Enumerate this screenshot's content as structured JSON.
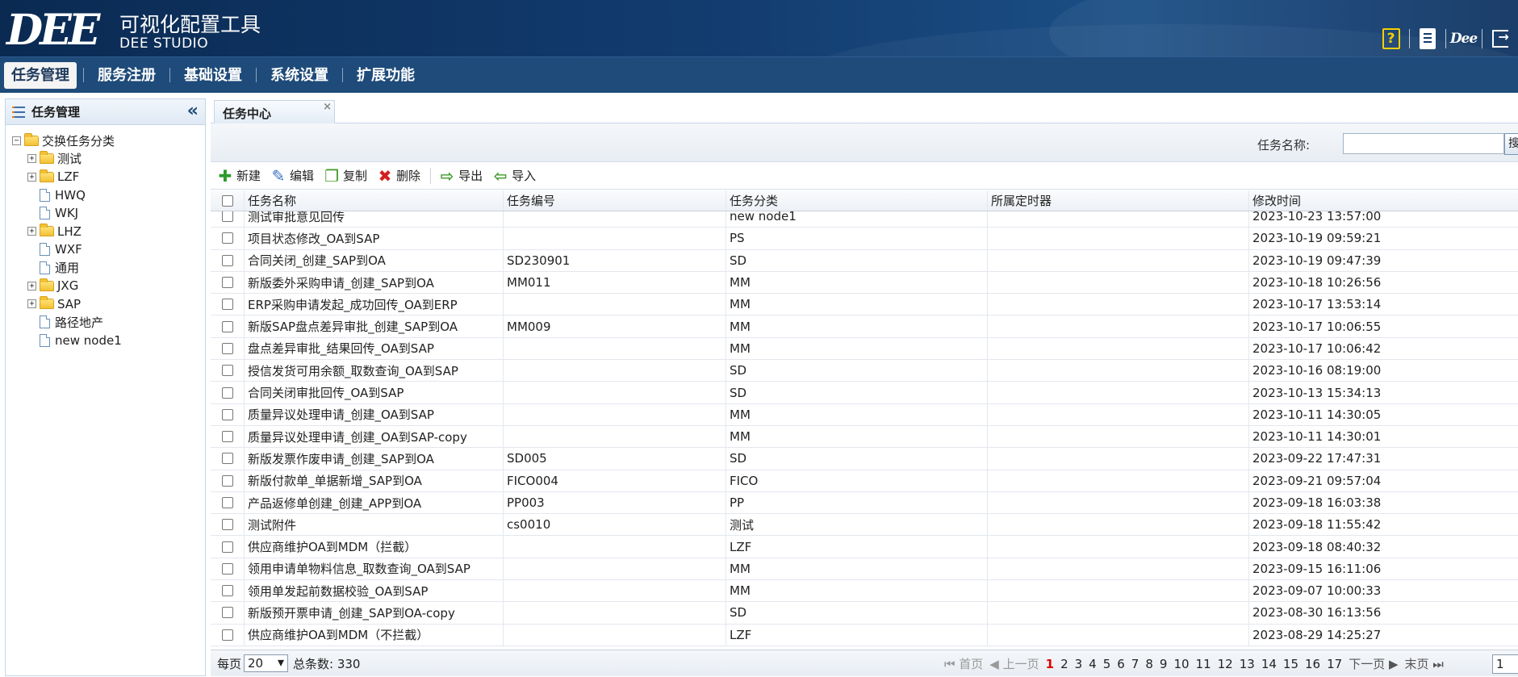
{
  "header": {
    "logo_mark": "DEE",
    "title_cn": "可视化配置工具",
    "title_en": "DEE STUDIO",
    "tools": [
      {
        "icon": "help-icon",
        "glyph": "?"
      },
      {
        "icon": "document-icon"
      },
      {
        "icon": "dee-logo-icon",
        "glyph": "Dee"
      },
      {
        "icon": "logout-icon"
      }
    ]
  },
  "menu": {
    "items": [
      "任务管理",
      "服务注册",
      "基础设置",
      "系统设置",
      "扩展功能"
    ],
    "active": 0
  },
  "left_panel": {
    "title": "任务管理",
    "collapse_glyph": "«",
    "tree_root": "交换任务分类",
    "nodes": [
      {
        "label": "测试",
        "type": "folder"
      },
      {
        "label": "LZF",
        "type": "folder"
      },
      {
        "label": "HWQ",
        "type": "page"
      },
      {
        "label": "WKJ",
        "type": "page"
      },
      {
        "label": "LHZ",
        "type": "folder"
      },
      {
        "label": "WXF",
        "type": "page"
      },
      {
        "label": "通用",
        "type": "page"
      },
      {
        "label": "JXG",
        "type": "folder"
      },
      {
        "label": "SAP",
        "type": "folder"
      },
      {
        "label": "路径地产",
        "type": "page"
      },
      {
        "label": "new node1",
        "type": "page"
      }
    ]
  },
  "tab": {
    "label": "任务中心",
    "close": "×"
  },
  "search": {
    "label": "任务名称:",
    "placeholder": "",
    "button": "搜索"
  },
  "toolbar": [
    {
      "label": "新建",
      "icon": "add-icon",
      "glyph": "✚",
      "color": "#2e9a2e"
    },
    {
      "label": "编辑",
      "icon": "edit-icon",
      "glyph": "✎",
      "color": "#3a6fc4"
    },
    {
      "label": "复制",
      "icon": "copy-icon",
      "glyph": "❐",
      "color": "#3f9a2a"
    },
    {
      "label": "删除",
      "icon": "delete-icon",
      "glyph": "✖",
      "color": "#d42020"
    },
    {
      "label": "导出",
      "icon": "export-icon",
      "glyph": "⇨",
      "color": "#3f9a2a"
    },
    {
      "label": "导入",
      "icon": "import-icon",
      "glyph": "⇦",
      "color": "#3f9a2a"
    }
  ],
  "grid": {
    "columns": [
      "任务名称",
      "任务编号",
      "任务分类",
      "所属定时器",
      "修改时间"
    ],
    "rows": [
      [
        "测试审批意见回传",
        "",
        "new node1",
        "",
        "2023-10-23 13:57:00"
      ],
      [
        "项目状态修改_OA到SAP",
        "",
        "PS",
        "",
        "2023-10-19 09:59:21"
      ],
      [
        "合同关闭_创建_SAP到OA",
        "SD230901",
        "SD",
        "",
        "2023-10-19 09:47:39"
      ],
      [
        "新版委外采购申请_创建_SAP到OA",
        "MM011",
        "MM",
        "",
        "2023-10-18 10:26:56"
      ],
      [
        "ERP采购申请发起_成功回传_OA到ERP",
        "",
        "MM",
        "",
        "2023-10-17 13:53:14"
      ],
      [
        "新版SAP盘点差异审批_创建_SAP到OA",
        "MM009",
        "MM",
        "",
        "2023-10-17 10:06:55"
      ],
      [
        "盘点差异审批_结果回传_OA到SAP",
        "",
        "MM",
        "",
        "2023-10-17 10:06:42"
      ],
      [
        "授信发货可用余额_取数查询_OA到SAP",
        "",
        "SD",
        "",
        "2023-10-16 08:19:00"
      ],
      [
        "合同关闭审批回传_OA到SAP",
        "",
        "SD",
        "",
        "2023-10-13 15:34:13"
      ],
      [
        "质量异议处理申请_创建_OA到SAP",
        "",
        "MM",
        "",
        "2023-10-11 14:30:05"
      ],
      [
        "质量异议处理申请_创建_OA到SAP-copy",
        "",
        "MM",
        "",
        "2023-10-11 14:30:01"
      ],
      [
        "新版发票作废申请_创建_SAP到OA",
        "SD005",
        "SD",
        "",
        "2023-09-22 17:47:31"
      ],
      [
        "新版付款单_单据新增_SAP到OA",
        "FICO004",
        "FICO",
        "",
        "2023-09-21 09:57:04"
      ],
      [
        "产品返修单创建_创建_APP到OA",
        "PP003",
        "PP",
        "",
        "2023-09-18 16:03:38"
      ],
      [
        "测试附件",
        "cs0010",
        "测试",
        "",
        "2023-09-18 11:55:42"
      ],
      [
        "供应商维护OA到MDM（拦截）",
        "",
        "LZF",
        "",
        "2023-09-18 08:40:32"
      ],
      [
        "领用申请单物料信息_取数查询_OA到SAP",
        "",
        "MM",
        "",
        "2023-09-15 16:11:06"
      ],
      [
        "领用单发起前数据校验_OA到SAP",
        "",
        "MM",
        "",
        "2023-09-07 10:00:33"
      ],
      [
        "新版预开票申请_创建_SAP到OA-copy",
        "",
        "SD",
        "",
        "2023-08-30 16:13:56"
      ],
      [
        "供应商维护OA到MDM（不拦截）",
        "",
        "LZF",
        "",
        "2023-08-29 14:25:27"
      ]
    ]
  },
  "pager": {
    "per_page_label": "每页",
    "per_page": "20",
    "total_label": "总条数: 330",
    "first": "首页",
    "prev": "上一页",
    "pages": [
      "1",
      "2",
      "3",
      "4",
      "5",
      "6",
      "7",
      "8",
      "9",
      "10",
      "11",
      "12",
      "13",
      "14",
      "15",
      "16",
      "17"
    ],
    "current": "1",
    "next": "下一页",
    "last": "末页",
    "page_input": "1"
  }
}
